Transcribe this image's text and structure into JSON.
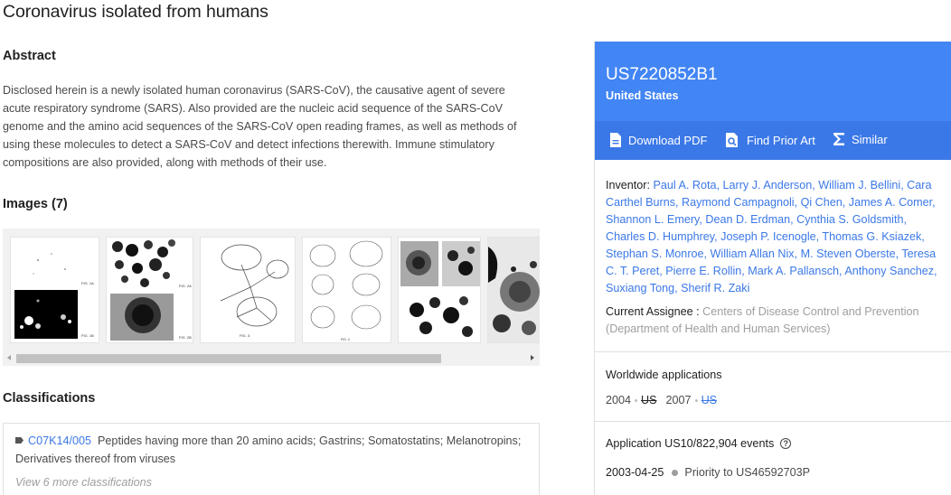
{
  "title": "Coronavirus isolated from humans",
  "abstract": {
    "heading": "Abstract",
    "text": "Disclosed herein is a newly isolated human coronavirus (SARS-CoV), the causative agent of severe acute respiratory syndrome (SARS). Also provided are the nucleic acid sequence of the SARS-CoV genome and the amino acid sequences of the SARS-CoV open reading frames, as well as methods of using these molecules to detect a SARS-CoV and detect infections therewith. Immune stimulatory compositions are also provided, along with methods of their use."
  },
  "images": {
    "heading": "Images (7)",
    "thumbnails": [
      "FIG. 1A / FIG. 1B",
      "FIG. 2A / FIG. 2B",
      "FIG. 3",
      "FIG. 4",
      "FIG. 5A / FIG. 5B / FIG. 5C",
      "FIG. 6"
    ]
  },
  "classifications": {
    "heading": "Classifications",
    "code": "C07K14/005",
    "description": "Peptides having more than 20 amino acids; Gastrins; Somatostatins; Melanotropins; Derivatives thereof from viruses",
    "view_more": "View 6 more classifications"
  },
  "panel": {
    "pub_number": "US7220852B1",
    "country": "United States",
    "actions": {
      "download": "Download PDF",
      "prior_art": "Find Prior Art",
      "similar": "Similar"
    },
    "inventor_label": "Inventor:",
    "inventors": "Paul A. Rota, Larry J. Anderson, William J. Bellini, Cara Carthel Burns, Raymond Campagnoli, Qi Chen, James A. Comer, Shannon L. Emery, Dean D. Erdman, Cynthia S. Goldsmith, Charles D. Humphrey, Joseph P. Icenogle, Thomas G. Ksiazek, Stephan S. Monroe, William Allan Nix, M. Steven Oberste, Teresa C. T. Peret, Pierre E. Rollin, Mark A. Pallansch, Anthony Sanchez, Suxiang Tong, Sherif R. Zaki",
    "assignee_label": "Current Assignee :",
    "assignee": "Centers of Disease Control and Prevention (Department of Health and Human Services)",
    "worldwide": {
      "title": "Worldwide applications",
      "year1": "2004",
      "us1": "US",
      "year2": "2007",
      "us2": "US"
    },
    "application": {
      "title": "Application US10/822,904 events",
      "event_date": "2003-04-25",
      "event_text": "Priority to US46592703P"
    }
  }
}
